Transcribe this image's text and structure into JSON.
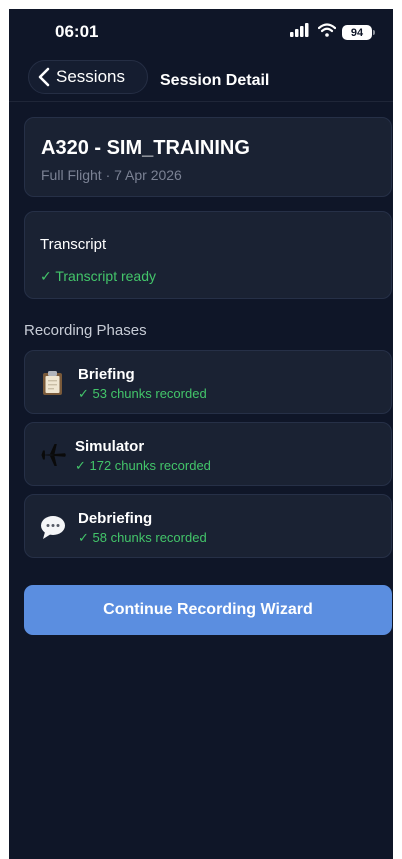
{
  "status_bar": {
    "time": "06:01",
    "battery": "94"
  },
  "nav": {
    "back_label": "Sessions",
    "title": "Session Detail"
  },
  "session": {
    "title": "A320 - SIM_TRAINING",
    "subtitle": "Full Flight · 7 Apr 2026"
  },
  "transcript": {
    "label": "Transcript",
    "status": "✓ Transcript ready"
  },
  "phases_section": {
    "label": "Recording Phases"
  },
  "phases": [
    {
      "name": "Briefing",
      "status": "✓ 53 chunks recorded",
      "icon": "clipboard-icon"
    },
    {
      "name": "Simulator",
      "status": "✓ 172 chunks recorded",
      "icon": "airplane-icon"
    },
    {
      "name": "Debriefing",
      "status": "✓ 58 chunks recorded",
      "icon": "speech-bubble-icon"
    }
  ],
  "cta": {
    "label": "Continue Recording Wizard"
  },
  "colors": {
    "background": "#0f1628",
    "card": "#1a2233",
    "success": "#43c56a",
    "primary": "#5b8ee0"
  }
}
